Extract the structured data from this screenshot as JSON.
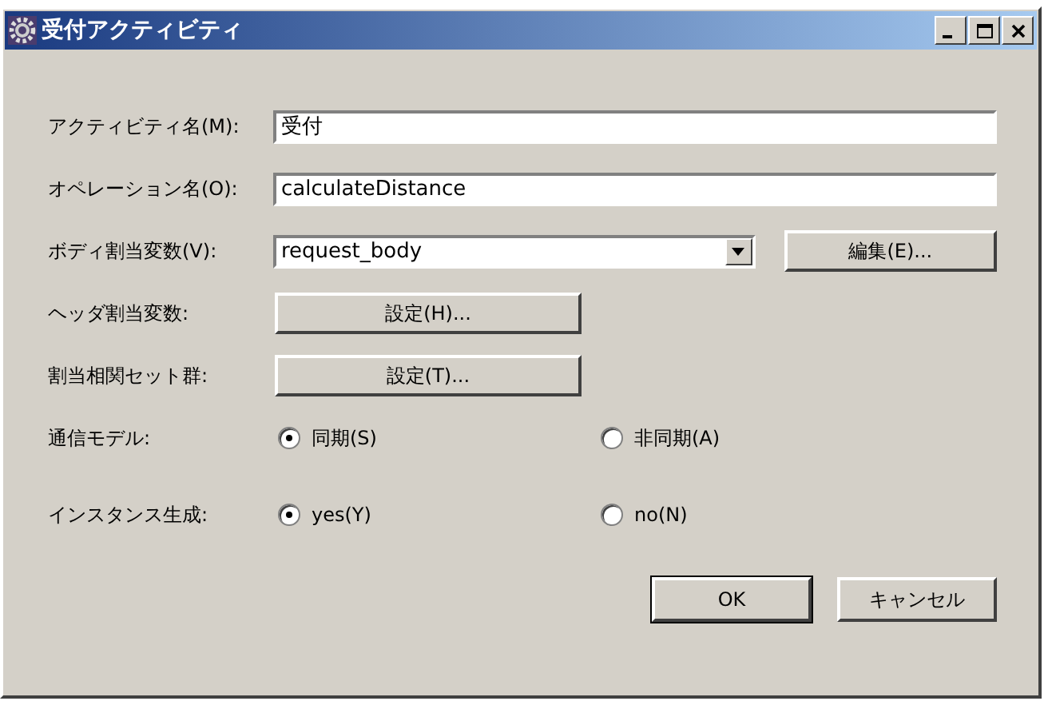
{
  "window": {
    "title": "受付アクティビティ",
    "controls": [
      {
        "kind": "minimize"
      },
      {
        "kind": "maximize"
      },
      {
        "kind": "close"
      }
    ]
  },
  "fields": [
    {
      "label": "アクティビティ名(M):",
      "kind": "text",
      "value": "受付"
    },
    {
      "label": "オペレーション名(O):",
      "kind": "text",
      "value": "calculateDistance"
    },
    {
      "label": "ボディ割当変数(V):",
      "kind": "combo",
      "value": "request_body",
      "button": "編集(E)..."
    },
    {
      "label": "ヘッダ割当変数:",
      "kind": "button",
      "button": "設定(H)..."
    },
    {
      "label": "割当相関セット群:",
      "kind": "button",
      "button": "設定(T)..."
    }
  ],
  "radio_groups": [
    {
      "label": "通信モデル:",
      "options": [
        {
          "label": "同期(S)",
          "selected": true
        },
        {
          "label": "非同期(A)",
          "selected": false
        }
      ]
    },
    {
      "label": "インスタンス生成:",
      "options": [
        {
          "label": "yes(Y)",
          "selected": true
        },
        {
          "label": "no(N)",
          "selected": false
        }
      ]
    }
  ],
  "buttons": [
    {
      "label": "OK",
      "default": true
    },
    {
      "label": "キャンセル",
      "default": false
    }
  ]
}
